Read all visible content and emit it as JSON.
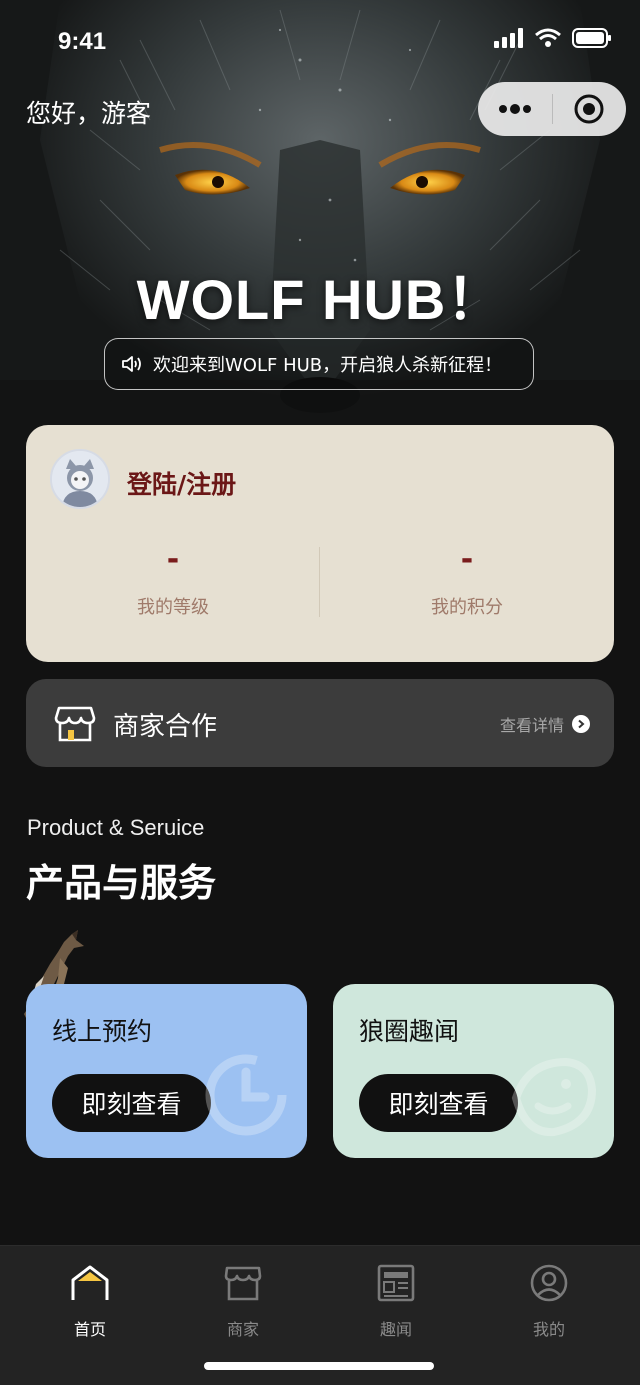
{
  "status_bar": {
    "time": "9:41"
  },
  "header": {
    "greeting": "您好，游客"
  },
  "hero": {
    "title": "WOLF HUB！",
    "notice": "欢迎来到WOLF HUB，开启狼人杀新征程！"
  },
  "user_card": {
    "login_label": "登陆/注册",
    "level": {
      "value": "-",
      "label": "我的等级"
    },
    "points": {
      "value": "-",
      "label": "我的积分"
    }
  },
  "merchant": {
    "title": "商家合作",
    "more": "查看详情"
  },
  "section": {
    "subtitle_en": "Product & Seruice",
    "title_zh": "产品与服务"
  },
  "cards": [
    {
      "title": "线上预约",
      "button": "即刻查看",
      "icon": "clock-icon",
      "color": "#9cc1f2"
    },
    {
      "title": "狼圈趣闻",
      "button": "即刻查看",
      "icon": "fish-icon",
      "color": "#cfe7dc"
    }
  ],
  "tabbar": {
    "items": [
      {
        "label": "首页",
        "icon": "home-icon",
        "active": true
      },
      {
        "label": "商家",
        "icon": "store-icon",
        "active": false
      },
      {
        "label": "趣闻",
        "icon": "news-icon",
        "active": false
      },
      {
        "label": "我的",
        "icon": "user-icon",
        "active": false
      }
    ]
  },
  "colors": {
    "login_text": "#6b1717",
    "card_bg": "#e6e0d2",
    "accent_yellow": "#f5c542"
  }
}
